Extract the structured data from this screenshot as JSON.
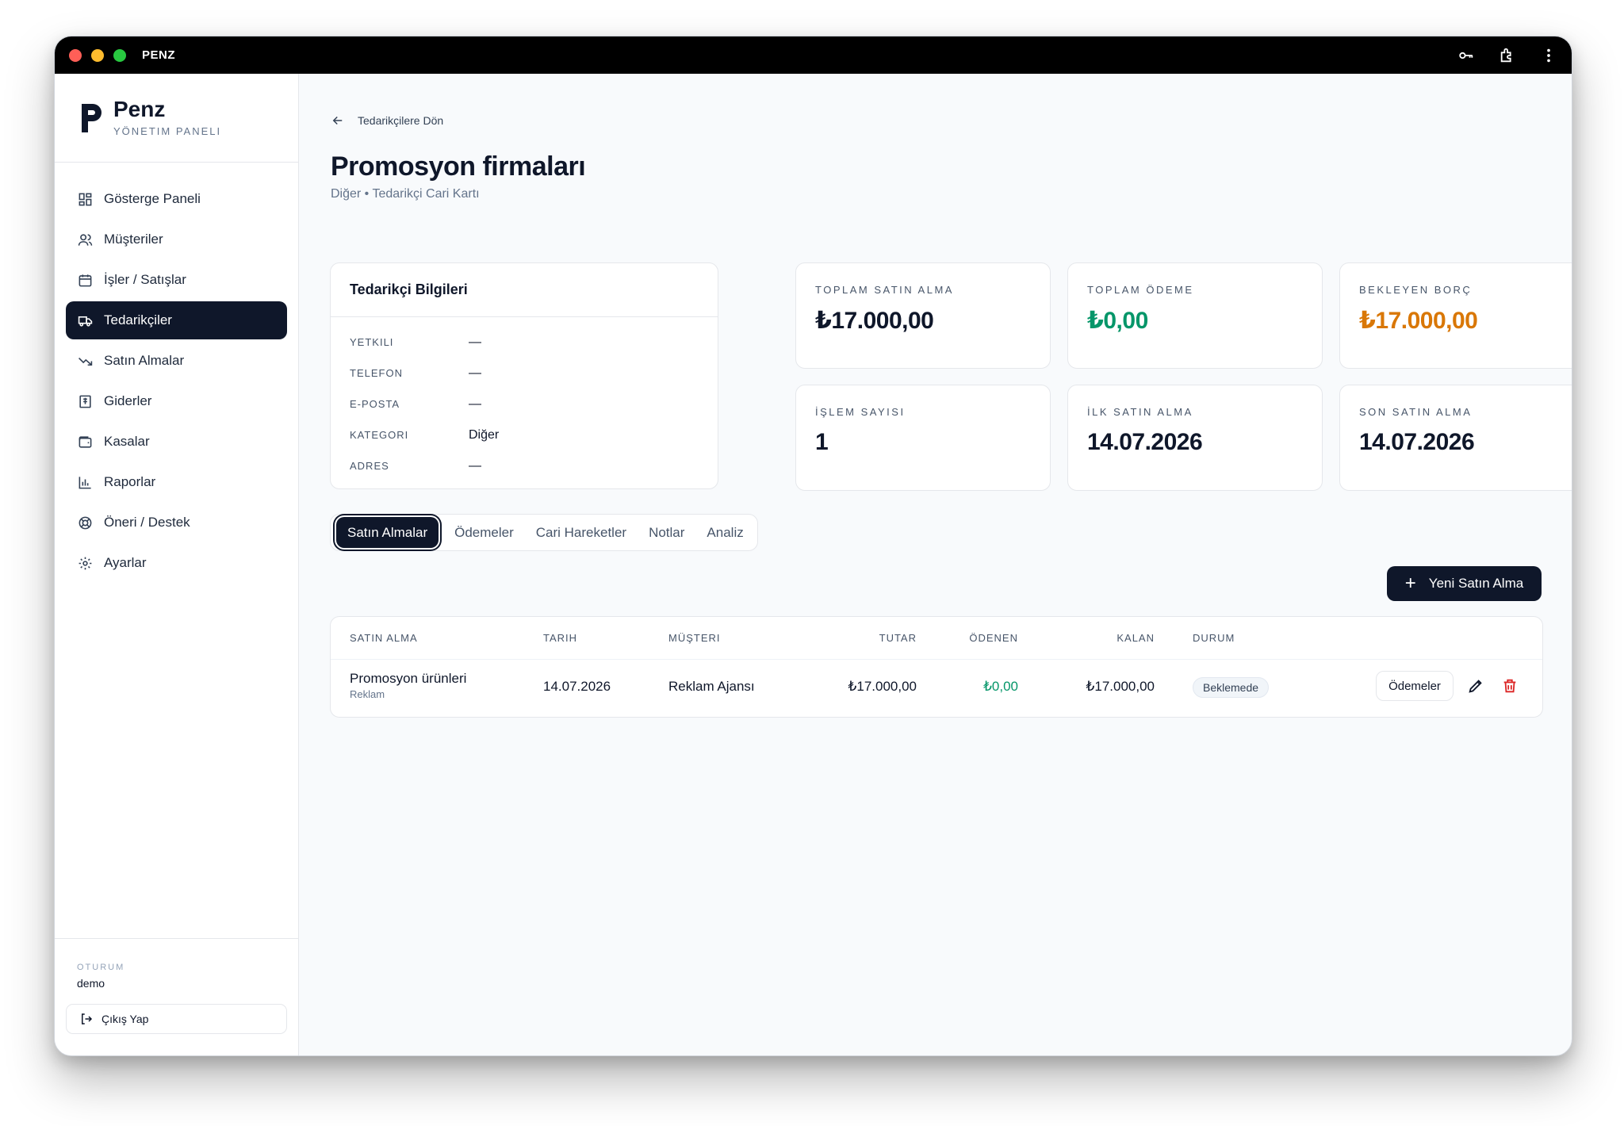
{
  "window": {
    "title": "PENZ"
  },
  "brand": {
    "name": "Penz",
    "subtitle": "YÖNETIM PANELI"
  },
  "sidebar": {
    "items": [
      {
        "label": "Gösterge Paneli",
        "icon": "dashboard-grid-icon"
      },
      {
        "label": "Müşteriler",
        "icon": "users-icon"
      },
      {
        "label": "İşler / Satışlar",
        "icon": "calendar-icon"
      },
      {
        "label": "Tedarikçiler",
        "icon": "truck-icon",
        "active": true
      },
      {
        "label": "Satın Almalar",
        "icon": "trend-down-icon"
      },
      {
        "label": "Giderler",
        "icon": "receipt-icon"
      },
      {
        "label": "Kasalar",
        "icon": "wallet-icon"
      },
      {
        "label": "Raporlar",
        "icon": "bar-chart-icon"
      },
      {
        "label": "Öneri / Destek",
        "icon": "lifebuoy-icon"
      },
      {
        "label": "Ayarlar",
        "icon": "gear-icon"
      }
    ],
    "session_label": "OTURUM",
    "user": "demo",
    "logout_label": "Çıkış Yap"
  },
  "header": {
    "back_label": "Tedarikçilere Dön",
    "title": "Promosyon firmaları",
    "subtitle": "Diğer • Tedarikçi Cari Kartı"
  },
  "info": {
    "title": "Tedarikçi Bilgileri",
    "rows": [
      {
        "key": "YETKILI",
        "value": "—"
      },
      {
        "key": "TELEFON",
        "value": "—"
      },
      {
        "key": "E-POSTA",
        "value": "—"
      },
      {
        "key": "KATEGORI",
        "value": "Diğer"
      },
      {
        "key": "ADRES",
        "value": "—"
      }
    ]
  },
  "stats": [
    {
      "label": "TOPLAM SATIN ALMA",
      "value": "₺17.000,00",
      "color": "#0f172a"
    },
    {
      "label": "TOPLAM ÖDEME",
      "value": "₺0,00",
      "color": "#059669"
    },
    {
      "label": "BEKLEYEN BORÇ",
      "value": "₺17.000,00",
      "color": "#d97706"
    },
    {
      "label": "İŞLEM SAYISI",
      "value": "1",
      "color": "#0f172a"
    },
    {
      "label": "İLK SATIN ALMA",
      "value": "14.07.2026",
      "color": "#0f172a"
    },
    {
      "label": "SON SATIN ALMA",
      "value": "14.07.2026",
      "color": "#0f172a"
    }
  ],
  "tabs": [
    "Satın Almalar",
    "Ödemeler",
    "Cari Hareketler",
    "Notlar",
    "Analiz"
  ],
  "new_button_label": "Yeni Satın Alma",
  "table": {
    "headers": [
      "SATIN ALMA",
      "TARIH",
      "MÜŞTERI",
      "TUTAR",
      "ÖDENEN",
      "KALAN",
      "DURUM"
    ],
    "rows": [
      {
        "title": "Promosyon ürünleri",
        "subtitle": "Reklam",
        "date": "14.07.2026",
        "customer": "Reklam Ajansı",
        "amount": "₺17.000,00",
        "paid": "₺0,00",
        "remaining": "₺17.000,00",
        "status": "Beklemede",
        "payments_label": "Ödemeler"
      }
    ]
  }
}
